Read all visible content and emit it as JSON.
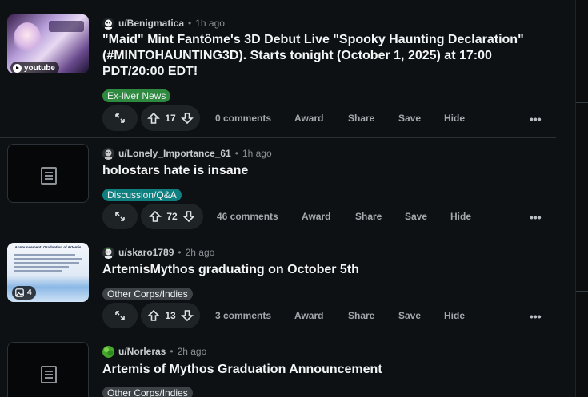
{
  "posts": [
    {
      "username": "u/Benigmatica",
      "time": "1h ago",
      "title": "\"Maid\" Mint Fantôme's 3D Debut Live \"Spooky Haunting Declaration\" (#MINTOHAUNTING3D). Starts tonight (October 1, 2025) at 17:00 PDT/20:00 EDT!",
      "flair": "Ex-liver News",
      "flair_color": "#2e8a3e",
      "votes": "17",
      "comments": "0 comments",
      "thumb_badge": "youtube"
    },
    {
      "username": "u/Lonely_Importance_61",
      "time": "1h ago",
      "title": "holostars hate is insane",
      "flair": "Discussion/Q&A",
      "flair_color": "#0f7f80",
      "votes": "72",
      "comments": "46 comments"
    },
    {
      "username": "u/skaro1789",
      "time": "2h ago",
      "title": "ArtemisMythos graduating on October 5th",
      "flair": "Other Corps/Indies",
      "flair_color": "#3c4246",
      "votes": "13",
      "comments": "3 comments",
      "thumb_title": "Announcement: Graduation of Artemis",
      "gallery_count": "4"
    },
    {
      "username": "u/Norleras",
      "time": "2h ago",
      "title": "Artemis of Mythos Graduation Announcement",
      "flair": "Other Corps/Indies",
      "flair_color": "#3c4246"
    }
  ],
  "labels": {
    "award": "Award",
    "share": "Share",
    "save": "Save",
    "hide": "Hide",
    "more": "•••",
    "sep": "•"
  },
  "icons": [
    "expand-icon",
    "upvote-icon",
    "downvote-icon",
    "text-post-icon",
    "gallery-icon",
    "youtube-play-icon",
    "more-icon"
  ]
}
